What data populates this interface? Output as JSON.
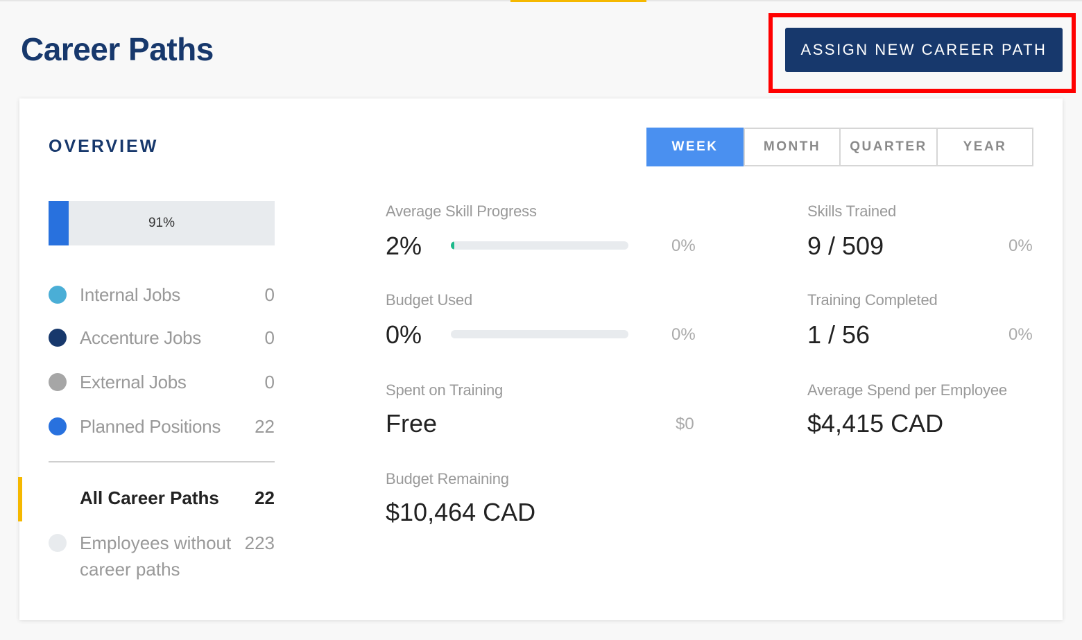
{
  "page": {
    "title": "Career Paths",
    "assign_button_label": "ASSIGN NEW CAREER PATH"
  },
  "overview": {
    "title": "OVERVIEW",
    "period_tabs": [
      {
        "label": "WEEK",
        "active": true
      },
      {
        "label": "MONTH",
        "active": false
      },
      {
        "label": "QUARTER",
        "active": false
      },
      {
        "label": "YEAR",
        "active": false
      }
    ],
    "coverage": {
      "label": "91%",
      "fill_fraction": 0.09
    },
    "legend": [
      {
        "label": "Internal Jobs",
        "value": "0",
        "color": "#4aaed6"
      },
      {
        "label": "Accenture Jobs",
        "value": "0",
        "color": "#17386c"
      },
      {
        "label": "External Jobs",
        "value": "0",
        "color": "#a6a6a6"
      },
      {
        "label": "Planned Positions",
        "value": "22",
        "color": "#2871de"
      }
    ],
    "all_career_paths": {
      "label": "All Career Paths",
      "value": "22"
    },
    "without_career_paths": {
      "label": "Employees without career paths",
      "value": "223"
    }
  },
  "metrics": {
    "avg_skill_progress": {
      "label": "Average Skill Progress",
      "value": "2%",
      "change": "0%",
      "bar_fraction": 0.02
    },
    "budget_used": {
      "label": "Budget Used",
      "value": "0%",
      "change": "0%",
      "bar_fraction": 0
    },
    "spent_on_training": {
      "label": "Spent on Training",
      "value": "Free",
      "change": "$0"
    },
    "budget_remaining": {
      "label": "Budget Remaining",
      "value": "$10,464 CAD"
    },
    "skills_trained": {
      "label": "Skills Trained",
      "value": "9 / 509",
      "change": "0%"
    },
    "training_completed": {
      "label": "Training Completed",
      "value": "1 / 56",
      "change": "0%"
    },
    "avg_spend_per_employee": {
      "label": "Average Spend per Employee",
      "value": "$4,415 CAD"
    }
  },
  "colors": {
    "brand": "#17386c",
    "tab_active": "#4a90f0",
    "accent": "#f5b800",
    "highlight": "#ff0000"
  }
}
